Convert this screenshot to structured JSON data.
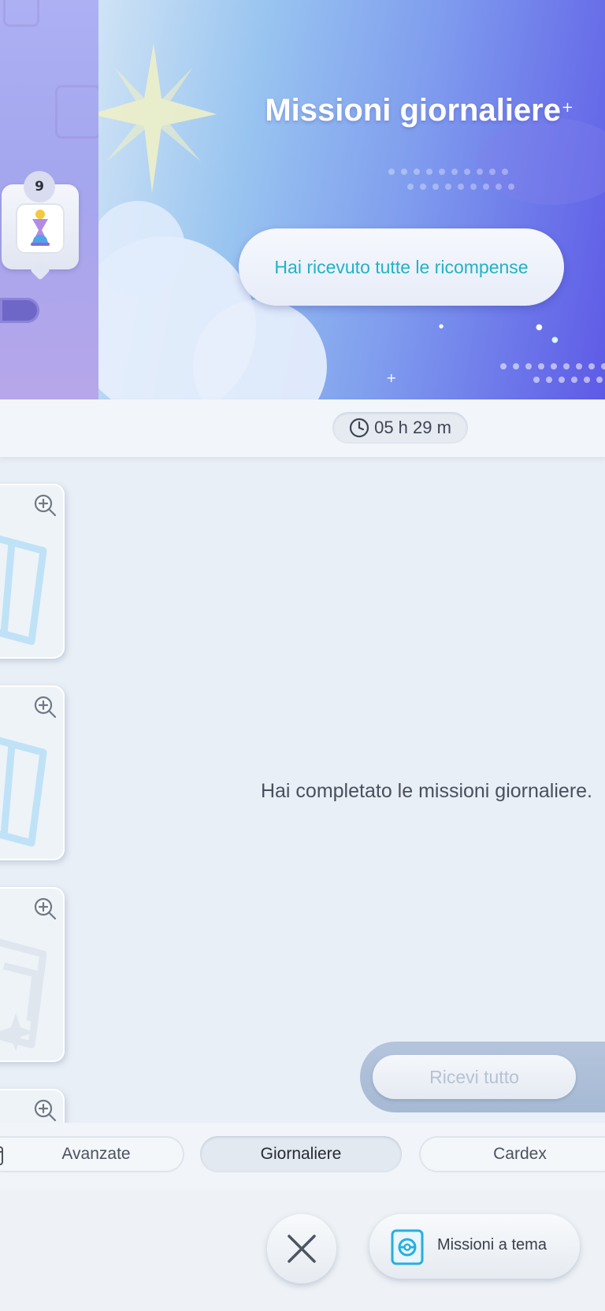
{
  "header": {
    "title": "Missioni giornaliere",
    "reward_status": "Hai ricevuto tutte le ricompense",
    "badge_level": "9"
  },
  "timer": {
    "value": "05 h 29 m",
    "icon": "clock-icon"
  },
  "main": {
    "completed_message": "Hai completato le missioni giornaliere.",
    "receive_all_label": "Ricevi tutto"
  },
  "tabs": [
    {
      "label": "Avanzate",
      "icon": "calendar-icon",
      "active": false
    },
    {
      "label": "Giornaliere",
      "active": true
    },
    {
      "label": "Cardex",
      "active": false
    }
  ],
  "bottom": {
    "close_icon": "close-icon",
    "theme_missions_label": "Missioni a tema",
    "theme_missions_icon": "card-pack-icon"
  },
  "colors": {
    "banner_start": "#cfe3f5",
    "banner_end": "#5e5ae6",
    "reward_text": "#1fb3c6",
    "disabled_text": "#b6c2d2"
  }
}
